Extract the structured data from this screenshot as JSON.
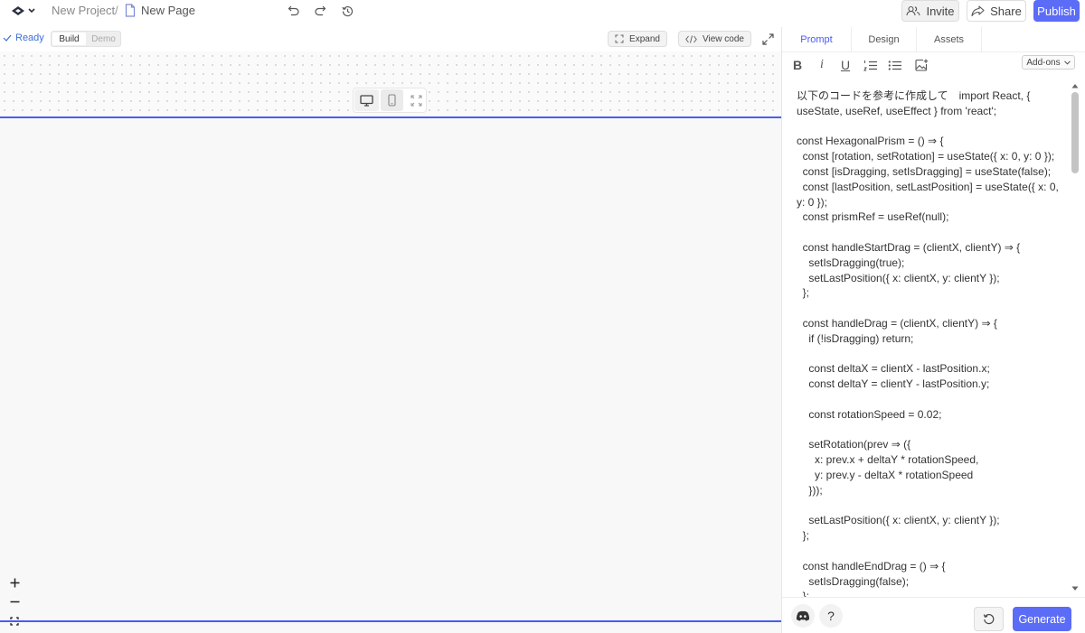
{
  "header": {
    "project_name": "New Project",
    "separator": "/",
    "page_name": "New Page",
    "invite_label": "Invite",
    "share_label": "Share",
    "publish_label": "Publish"
  },
  "toolbar": {
    "status": "Ready",
    "mode_build": "Build",
    "mode_demo": "Demo",
    "expand_label": "Expand",
    "view_code_label": "View code"
  },
  "panel": {
    "tabs": [
      "Prompt",
      "Design",
      "Assets"
    ],
    "addons_label": "Add-ons",
    "generate_label": "Generate",
    "help_label": "?"
  },
  "prompt_lines": [
    "以下のコードを参考に作成して　import React, { useState, useRef, useEffect } from 'react';",
    "",
    "const HexagonalPrism = () ⇒ {",
    "  const [rotation, setRotation] = useState({ x: 0, y: 0 });",
    "  const [isDragging, setIsDragging] = useState(false);",
    "  const [lastPosition, setLastPosition] = useState({ x: 0, y: 0 });",
    "  const prismRef = useRef(null);",
    "",
    "  const handleStartDrag = (clientX, clientY) ⇒ {",
    "    setIsDragging(true);",
    "    setLastPosition({ x: clientX, y: clientY });",
    "  };",
    "",
    "  const handleDrag = (clientX, clientY) ⇒ {",
    "    if (!isDragging) return;",
    "",
    "    const deltaX = clientX - lastPosition.x;",
    "    const deltaY = clientY - lastPosition.y;",
    "",
    "    const rotationSpeed = 0.02;",
    "",
    "    setRotation(prev ⇒ ({",
    "      x: prev.x + deltaY * rotationSpeed,",
    "      y: prev.y - deltaX * rotationSpeed",
    "    }));",
    "",
    "    setLastPosition({ x: clientX, y: clientY });",
    "  };",
    "",
    "  const handleEndDrag = () ⇒ {",
    "    setIsDragging(false);",
    "  };"
  ],
  "colors": {
    "accent": "#5b6cf6",
    "canvas_line": "#4a5cf0",
    "status_blue": "#3b6fd8"
  }
}
